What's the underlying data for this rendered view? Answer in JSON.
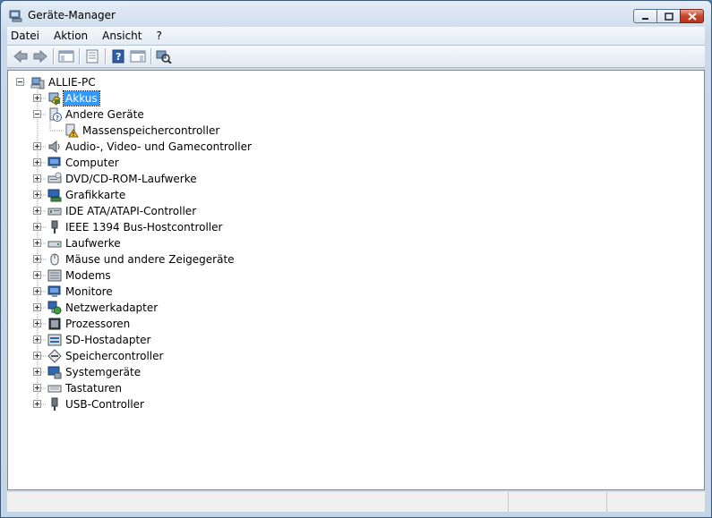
{
  "window": {
    "title": "Geräte-Manager"
  },
  "menu": [
    "Datei",
    "Aktion",
    "Ansicht",
    "?"
  ],
  "toolbar": [
    {
      "name": "back-icon"
    },
    {
      "name": "forward-icon"
    },
    {
      "name": "show-hide-console-tree-icon"
    },
    {
      "name": "properties-icon"
    },
    {
      "name": "help-icon"
    },
    {
      "name": "action-pane-icon"
    },
    {
      "name": "scan-hardware-icon"
    }
  ],
  "tree": {
    "root": {
      "label": "ALLIE-PC",
      "icon": "computer-icon"
    },
    "items": [
      {
        "label": "Akkus",
        "icon": "battery-icon",
        "selected": true,
        "expanded": false
      },
      {
        "label": "Andere Geräte",
        "icon": "unknown-device-icon",
        "expanded": true,
        "children": [
          {
            "label": "Massenspeichercontroller",
            "icon": "warning-device-icon"
          }
        ]
      },
      {
        "label": "Audio-, Video- und Gamecontroller",
        "icon": "speaker-icon"
      },
      {
        "label": "Computer",
        "icon": "monitor-icon"
      },
      {
        "label": "DVD/CD-ROM-Laufwerke",
        "icon": "cdrom-icon"
      },
      {
        "label": "Grafikkarte",
        "icon": "display-adapter-icon"
      },
      {
        "label": "IDE ATA/ATAPI-Controller",
        "icon": "ide-controller-icon"
      },
      {
        "label": "IEEE 1394 Bus-Hostcontroller",
        "icon": "firewire-icon"
      },
      {
        "label": "Laufwerke",
        "icon": "disk-drive-icon"
      },
      {
        "label": "Mäuse und andere Zeigegeräte",
        "icon": "mouse-icon"
      },
      {
        "label": "Modems",
        "icon": "modem-icon"
      },
      {
        "label": "Monitore",
        "icon": "monitor-icon"
      },
      {
        "label": "Netzwerkadapter",
        "icon": "network-adapter-icon"
      },
      {
        "label": "Prozessoren",
        "icon": "processor-icon"
      },
      {
        "label": "SD-Hostadapter",
        "icon": "sd-host-icon"
      },
      {
        "label": "Speichercontroller",
        "icon": "storage-controller-icon"
      },
      {
        "label": "Systemgeräte",
        "icon": "system-device-icon"
      },
      {
        "label": "Tastaturen",
        "icon": "keyboard-icon"
      },
      {
        "label": "USB-Controller",
        "icon": "usb-icon"
      }
    ]
  },
  "statusbar": {
    "cells": [
      "",
      "",
      ""
    ]
  }
}
